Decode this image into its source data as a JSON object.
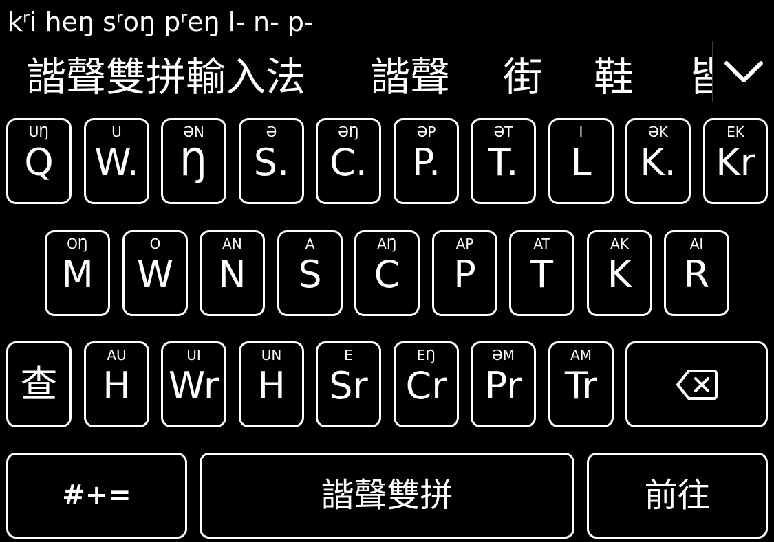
{
  "composition": "kʳi heŋ sʳoŋ pʳeŋ l- n- p-",
  "candidates": [
    "諧聲雙拼輸入法",
    "諧聲",
    "街",
    "鞋",
    "皆"
  ],
  "expand_icon": "chevron-down-icon",
  "rows": [
    [
      {
        "hint": "UŊ",
        "label": "Q"
      },
      {
        "hint": "U",
        "label": "W."
      },
      {
        "hint": "ƏN",
        "label": "Ŋ"
      },
      {
        "hint": "Ə",
        "label": "S."
      },
      {
        "hint": "ƏŊ",
        "label": "C."
      },
      {
        "hint": "ƏP",
        "label": "P."
      },
      {
        "hint": "ƏT",
        "label": "T."
      },
      {
        "hint": "I",
        "label": "L"
      },
      {
        "hint": "ƏK",
        "label": "K."
      },
      {
        "hint": "EK",
        "label": "Kr"
      }
    ],
    [
      {
        "hint": "OŊ",
        "label": "M"
      },
      {
        "hint": "O",
        "label": "W"
      },
      {
        "hint": "AN",
        "label": "N"
      },
      {
        "hint": "A",
        "label": "S"
      },
      {
        "hint": "AŊ",
        "label": "C"
      },
      {
        "hint": "AP",
        "label": "P"
      },
      {
        "hint": "AT",
        "label": "T"
      },
      {
        "hint": "AK",
        "label": "K"
      },
      {
        "hint": "AI",
        "label": "R"
      }
    ],
    [
      {
        "hint": "",
        "label": "查"
      },
      {
        "hint": "AU",
        "label": "H"
      },
      {
        "hint": "UI",
        "label": "Wr"
      },
      {
        "hint": "UN",
        "label": "H"
      },
      {
        "hint": "E",
        "label": "Sr"
      },
      {
        "hint": "EŊ",
        "label": "Cr"
      },
      {
        "hint": "ƏM",
        "label": "Pr"
      },
      {
        "hint": "AM",
        "label": "Tr"
      }
    ]
  ],
  "backspace_icon": "backspace-icon",
  "bottom_row": {
    "symbols": "#+=",
    "space": "諧聲雙拼",
    "go": "前往"
  }
}
